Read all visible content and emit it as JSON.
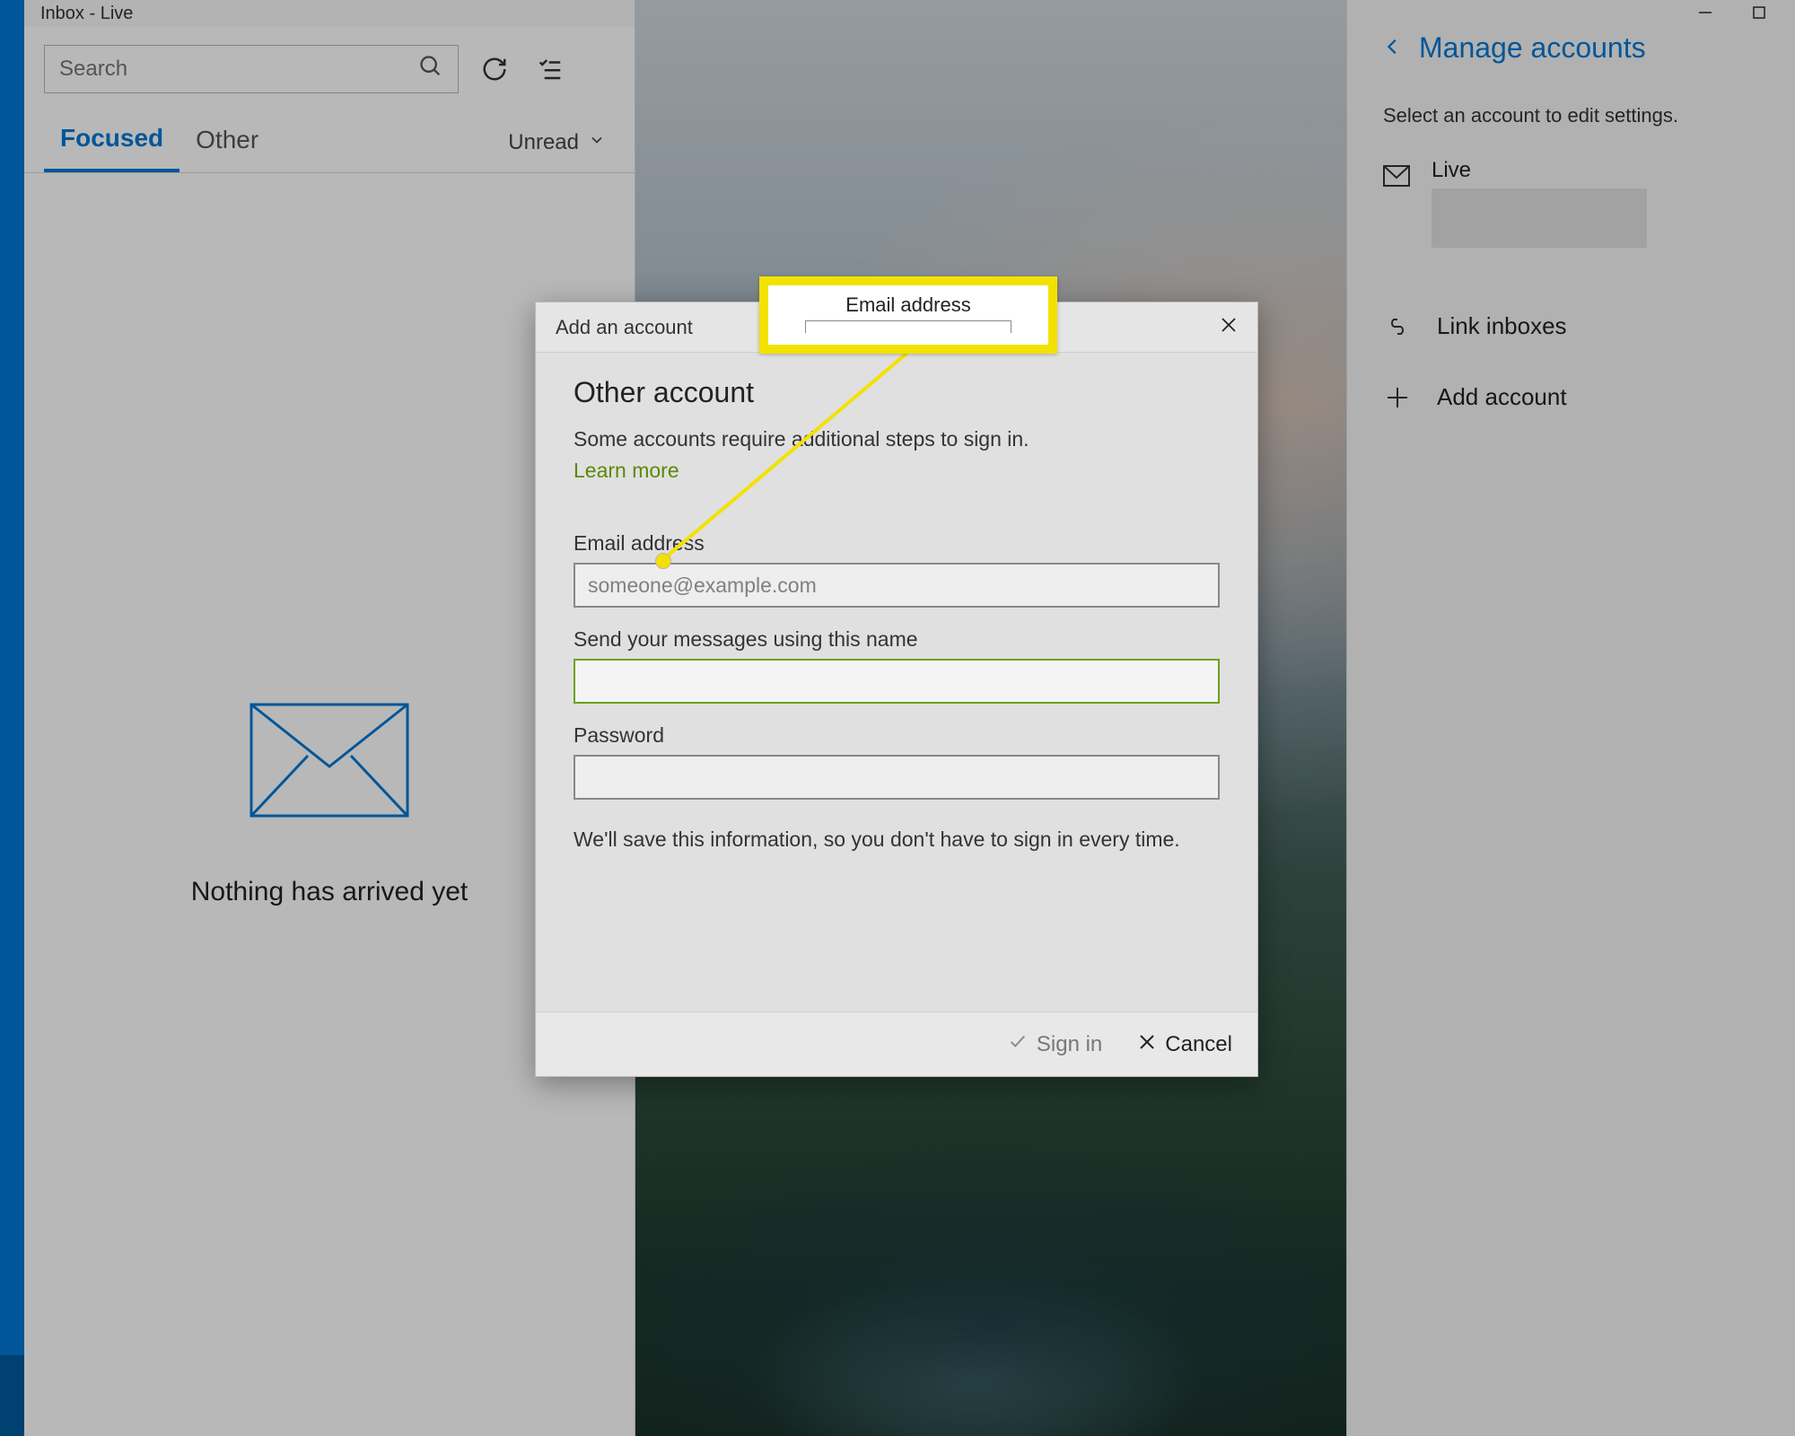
{
  "window": {
    "title": "Inbox - Live"
  },
  "inbox": {
    "search_placeholder": "Search",
    "tabs": {
      "focused": "Focused",
      "other": "Other"
    },
    "filter_label": "Unread",
    "empty_message": "Nothing has arrived yet"
  },
  "right_panel": {
    "title": "Manage accounts",
    "subtitle": "Select an account to edit settings.",
    "account_name": "Live",
    "link_inboxes": "Link inboxes",
    "add_account": "Add account"
  },
  "modal": {
    "window_title": "Add an account",
    "heading": "Other account",
    "description": "Some accounts require additional steps to sign in.",
    "learn_more": "Learn more",
    "email_label": "Email address",
    "email_placeholder": "someone@example.com",
    "name_label": "Send your messages using this name",
    "password_label": "Password",
    "save_note": "We'll save this information, so you don't have to sign in every time.",
    "sign_in": "Sign in",
    "cancel": "Cancel"
  },
  "callout": {
    "label": "Email address"
  }
}
